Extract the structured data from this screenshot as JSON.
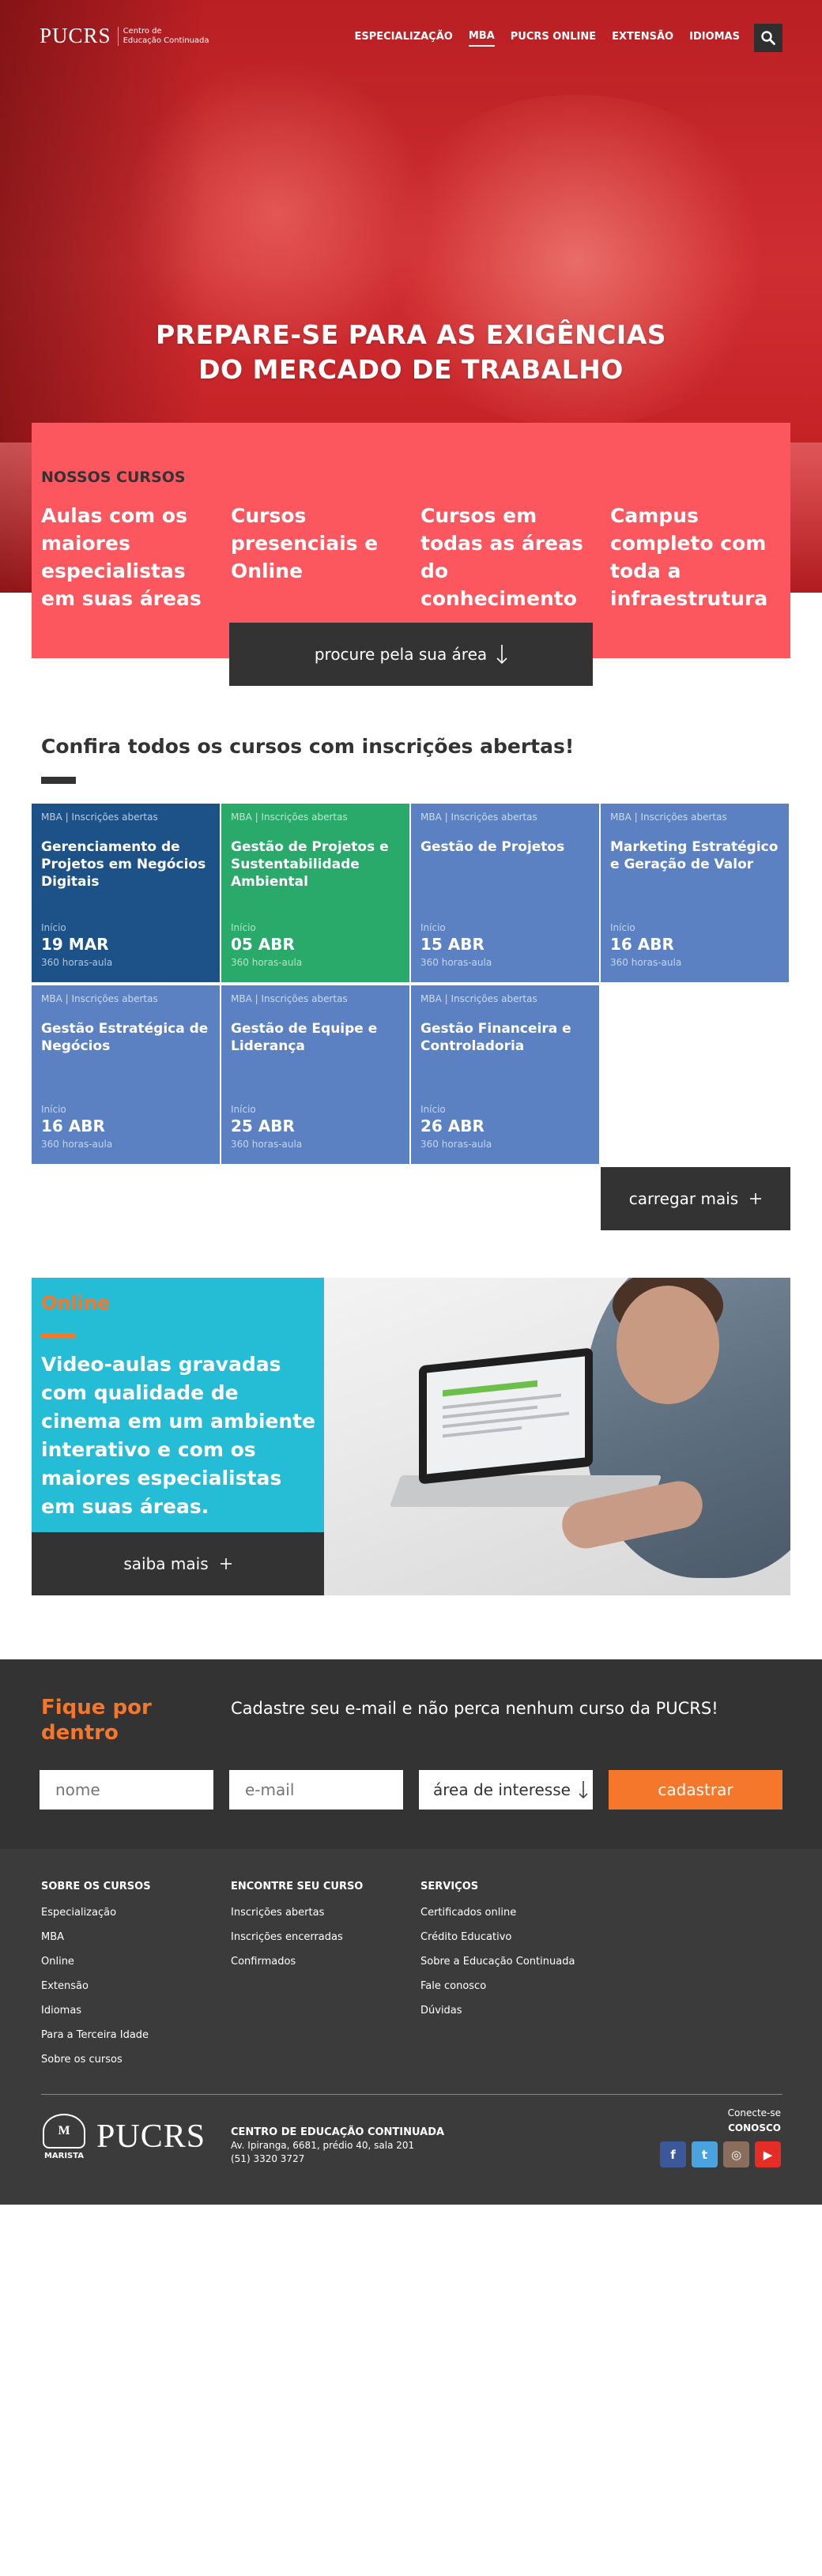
{
  "brand": {
    "name": "PUCRS",
    "subtitle_line1": "Centro de",
    "subtitle_line2": "Educação Continuada"
  },
  "nav": {
    "items": [
      "ESPECIALIZAÇÃO",
      "MBA",
      "PUCRS ONLINE",
      "EXTENSÃO",
      "IDIOMAS"
    ],
    "active": "MBA",
    "search_icon": "search-icon"
  },
  "hero": {
    "title_line1": "PREPARE-SE PARA AS EXIGÊNCIAS",
    "title_line2": "DO MERCADO DE TRABALHO"
  },
  "courses_panel": {
    "kicker": "NOSSOS CURSOS",
    "features": [
      "Aulas com os maiores especialistas em suas áreas",
      "Cursos presenciais e Online",
      "Cursos em todas as áreas do conhecimento",
      "Campus completo com toda a infraestrutura"
    ],
    "area_button": "procure pela sua área",
    "area_icon": "arrow-down-icon"
  },
  "open_courses": {
    "title": "Confira todos os cursos com inscrições abertas!",
    "start_label": "Início",
    "cards": [
      {
        "meta": "MBA | Inscrições abertas",
        "title": "Gerenciamento de Projetos em Negócios Digitais",
        "date": "19 MAR",
        "hours": "360 horas-aula",
        "color": "#1d5289"
      },
      {
        "meta": "MBA | Inscrições abertas",
        "title": "Gestão de Projetos e Sustentabilidade Ambiental",
        "date": "05 ABR",
        "hours": "360 horas-aula",
        "color": "#2aaa6a"
      },
      {
        "meta": "MBA | Inscrições abertas",
        "title": "Gestão de Projetos",
        "date": "15 ABR",
        "hours": "360 horas-aula",
        "color": "#5b81c3"
      },
      {
        "meta": "MBA | Inscrições abertas",
        "title": "Marketing Estratégico e Geração de Valor",
        "date": "16 ABR",
        "hours": "360 horas-aula",
        "color": "#5b81c3"
      },
      {
        "meta": "MBA | Inscrições abertas",
        "title": "Gestão Estratégica de Negócios",
        "date": "16 ABR",
        "hours": "360 horas-aula",
        "color": "#5b81c3"
      },
      {
        "meta": "MBA | Inscrições abertas",
        "title": "Gestão de Equipe e Liderança",
        "date": "25 ABR",
        "hours": "360 horas-aula",
        "color": "#5b81c3"
      },
      {
        "meta": "MBA | Inscrições abertas",
        "title": "Gestão Financeira e Controladoria",
        "date": "26 ABR",
        "hours": "360 horas-aula",
        "color": "#5b81c3"
      }
    ],
    "load_more": "carregar mais",
    "plus_icon": "plus-icon"
  },
  "online": {
    "kicker": "Online",
    "text": "Video-aulas gravadas com qualidade de cinema em um ambiente interativo e com os maiores especialistas em suas áreas.",
    "more_button": "saiba mais"
  },
  "newsletter": {
    "title_line1": "Fique por",
    "title_line2": "dentro",
    "description": "Cadastre seu e-mail e não perca nenhum curso da PUCRS!",
    "name_placeholder": "nome",
    "email_placeholder": "e-mail",
    "interest_label": "área de interesse",
    "submit": "cadastrar"
  },
  "footer": {
    "columns": [
      {
        "heading": "SOBRE OS CURSOS",
        "links": [
          "Especialização",
          "MBA",
          "Online",
          "Extensão",
          "Idiomas",
          "Para a Terceira Idade",
          "Sobre os cursos"
        ]
      },
      {
        "heading": "ENCONTRE SEU CURSO",
        "links": [
          "Inscrições abertas",
          "Inscrições encerradas",
          "Confirmados"
        ]
      },
      {
        "heading": "SERVIÇOS",
        "links": [
          "Certificados online",
          "Crédito Educativo",
          "Sobre a Educação Continuada",
          "Fale conosco",
          "Dúvidas"
        ]
      }
    ],
    "marista": "MARISTA",
    "brand": "PUCRS",
    "address_title": "CENTRO DE EDUCAÇÃO CONTINUADA",
    "address_line": "Av. Ipiranga, 6681, prédio 40, sala 201",
    "phone": "(51) 3320 3727",
    "connect_line1": "Conecte-se",
    "connect_line2": "CONOSCO",
    "social": [
      {
        "name": "facebook-icon",
        "glyph": "f",
        "color": "#3b5998"
      },
      {
        "name": "twitter-icon",
        "glyph": "t",
        "color": "#4aa3df"
      },
      {
        "name": "instagram-icon",
        "glyph": "◎",
        "color": "#8a6d5b"
      },
      {
        "name": "youtube-icon",
        "glyph": "▶",
        "color": "#e52d27"
      }
    ]
  }
}
